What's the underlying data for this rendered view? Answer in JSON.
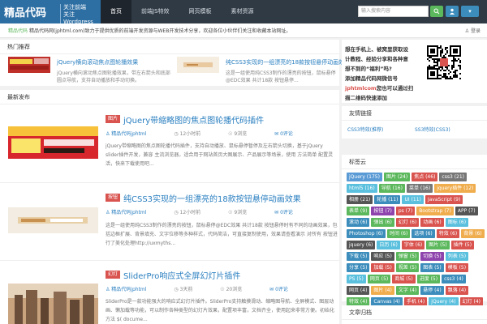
{
  "header": {
    "logo_main": "精品代码",
    "logo_sub_1": "关注前端",
    "logo_sub_2": "关注Wordpress",
    "nav": [
      "首页",
      "前端JS特效",
      "网页模板",
      "素材资源"
    ],
    "search_placeholder": "输入搜索内容"
  },
  "notice": {
    "tag": "精品代码",
    "text": "精品代码网(jphtml.com)致力于提供优质的前端开发资源与WEB开发技术分享，欢迎各位小伙伴们关注和收藏本站网址。",
    "user": "登录"
  },
  "recommend": {
    "title": "热门推荐",
    "items": [
      {
        "title": "jQuery横向滚动焦点图轮播效果",
        "desc": "jQuery横向滚动焦点图轮播效果，带左右箭头和底部圆点导航，支持自动播放和手动切换。"
      },
      {
        "title": "纯CSS3实现的一组漂亮的18款按钮悬停动画效果",
        "desc": "这是一组使用纯CSS3制作的漂亮的按钮，鼠标悬停@EDC效果 共计18款 按钮悬停..."
      }
    ]
  },
  "latest": {
    "title": "最新发布",
    "posts": [
      {
        "category": "图片",
        "title": "jQuery带缩略图的焦点图轮播代码插件",
        "author": "精品代码jphtml",
        "date": "12小时前",
        "views": "9浏览",
        "comments": "0评论",
        "excerpt": "jQuery带缩略图的焦点图轮播代码插件，支持自动播放、鼠标悬停暂停及左右箭头切换，基于jQuery slider插件开发，兼容 主流浏览器，适合用于网站首页大图展示、产品展示等场景，使用 方法简单 配置灵活，快来下载使用吧..."
      },
      {
        "category": "按钮",
        "title": "纯CSS3实现的一组漂亮的18款按钮悬停动画效果",
        "author": "精品代码jphtml",
        "date": "12小时前",
        "views": "9浏览",
        "comments": "0评论",
        "excerpt": "这是一组使用纯CSS3制作的漂亮的按钮，鼠标悬停@EDC效果 共计18款 按钮悬停时有不同的动画效果，包括边框扩展、背景填充、文字位移等多种样式，代码简洁，可直接复制使用，效果请查看演示 对所有 按钮进行了美化处理http://uxmyths..."
      },
      {
        "category": "幻灯",
        "title": "SliderPro响应式全屏幻灯片插件",
        "author": "精品代码jphtml",
        "date": "3天前",
        "views": "20浏览",
        "comments": "0评论",
        "excerpt": "SliderPro是一款功能强大的响应式幻灯片插件。SliderPro支持触摸滑动、缩略图导航、全屏模式、图层动画、懒加载等功能，可以制作各种类型的幻灯片效果，配置项丰富，文档齐全，使用起来非常方便。初始化方法 $( docume..."
      }
    ]
  },
  "wechat": {
    "line1": "想在手机上、被窝里获取设",
    "line2": "计教程、经验分享和各种意",
    "line3": "想不到的“福利”吗?",
    "line4": "添加精品代码网微信号",
    "account": "jphtmlcom",
    "line5_a": "您也可以通过扫",
    "line6": "描二维码快速添加"
  },
  "friend_links": {
    "title": "友情链接",
    "links": [
      "CSS3特效(推荐)",
      "SS3特效(CSS3)"
    ]
  },
  "tag_cloud": {
    "title": "标签云",
    "tags": [
      {
        "t": "jQuery (175)",
        "c": "#5b9bd5"
      },
      {
        "t": "图片 (24)",
        "c": "#5cb85c"
      },
      {
        "t": "焦点 (46)",
        "c": "#d9534f"
      },
      {
        "t": "css3 (21)",
        "c": "#777777"
      },
      {
        "t": "html5 (16)",
        "c": "#5bc0de"
      },
      {
        "t": "导航 (16)",
        "c": "#5cb85c"
      },
      {
        "t": "菜单 (16)",
        "c": "#777777"
      },
      {
        "t": "jquery插件 (12)",
        "c": "#f0ad4e"
      },
      {
        "t": "相册 (21)",
        "c": "#555555"
      },
      {
        "t": "轮播 (11)",
        "c": "#3c8dbc"
      },
      {
        "t": "UI (11)",
        "c": "#5bc0de"
      },
      {
        "t": "JavaScript (9)",
        "c": "#d9534f"
      },
      {
        "t": "表单 (9)",
        "c": "#5cb85c"
      },
      {
        "t": "按钮 (7)",
        "c": "#8e44ad"
      },
      {
        "t": "ps (7)",
        "c": "#d9534f"
      },
      {
        "t": "Bootstrap (7)",
        "c": "#f0ad4e"
      },
      {
        "t": "APP (7)",
        "c": "#555555"
      },
      {
        "t": "滚动 (6)",
        "c": "#3c8dbc"
      },
      {
        "t": "弹出 (6)",
        "c": "#5cb85c"
      },
      {
        "t": "幻灯 (6)",
        "c": "#d9534f"
      },
      {
        "t": "动画 (6)",
        "c": "#d9534f"
      },
      {
        "t": "图标 (6)",
        "c": "#5bc0de"
      },
      {
        "t": "Photoshop (6)",
        "c": "#3c8dbc"
      },
      {
        "t": "时间 (6)",
        "c": "#5cb85c"
      },
      {
        "t": "选项 (6)",
        "c": "#3c8dbc"
      },
      {
        "t": "特效 (6)",
        "c": "#d9534f"
      },
      {
        "t": "背景 (6)",
        "c": "#f0ad4e"
      },
      {
        "t": "jquery (6)",
        "c": "#555555"
      },
      {
        "t": "日历 (6)",
        "c": "#5bc0de"
      },
      {
        "t": "字体 (6)",
        "c": "#d9534f"
      },
      {
        "t": "图片 (5)",
        "c": "#5cb85c"
      },
      {
        "t": "插件 (5)",
        "c": "#d9534f"
      },
      {
        "t": "下载 (5)",
        "c": "#3c8dbc"
      },
      {
        "t": "响应 (5)",
        "c": "#555555"
      },
      {
        "t": "弹窗 (5)",
        "c": "#5cb85c"
      },
      {
        "t": "切换 (5)",
        "c": "#8e44ad"
      },
      {
        "t": "列表 (5)",
        "c": "#5bc0de"
      },
      {
        "t": "分享 (5)",
        "c": "#3c8dbc"
      },
      {
        "t": "加载 (5)",
        "c": "#d9534f"
      },
      {
        "t": "视差 (5)",
        "c": "#5cb85c"
      },
      {
        "t": "图表 (5)",
        "c": "#3c8dbc"
      },
      {
        "t": "模板 (5)",
        "c": "#d9534f"
      },
      {
        "t": "PS (5)",
        "c": "#5bc0de"
      },
      {
        "t": "网页 (5)",
        "c": "#5cb85c"
      },
      {
        "t": "商城 (5)",
        "c": "#d9534f"
      },
      {
        "t": "进度 (5)",
        "c": "#5cb85c"
      },
      {
        "t": "css3 (4)",
        "c": "#3c8dbc"
      },
      {
        "t": "网页 (4)",
        "c": "#555555"
      },
      {
        "t": "图片 (4)",
        "c": "#f0ad4e"
      },
      {
        "t": "文字 (4)",
        "c": "#5cb85c"
      },
      {
        "t": "悬停 (4)",
        "c": "#3c8dbc"
      },
      {
        "t": "飘落 (4)",
        "c": "#d9534f"
      },
      {
        "t": "特效 (4)",
        "c": "#5cb85c"
      },
      {
        "t": "Canvas (4)",
        "c": "#3c8dbc"
      },
      {
        "t": "手机 (4)",
        "c": "#d9534f"
      },
      {
        "t": "jQuery (4)",
        "c": "#5bc0de"
      },
      {
        "t": "幻灯 (4)",
        "c": "#d9534f"
      }
    ]
  },
  "archive": {
    "title": "文章归档"
  }
}
